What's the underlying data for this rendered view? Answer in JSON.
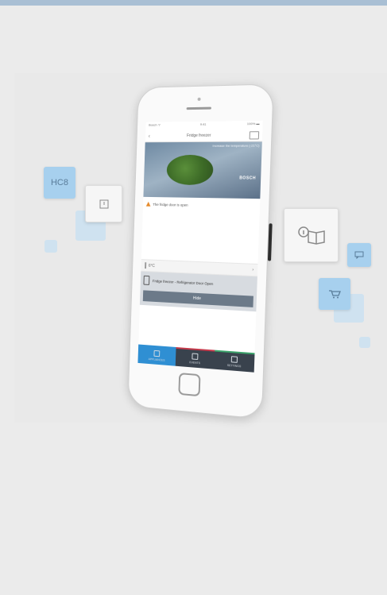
{
  "phone": {
    "status_left": "Bosch ᯤ",
    "status_center": "9:41",
    "status_right": "100% ▬",
    "nav_back": "‹",
    "nav_title": "Fridge freezer",
    "banner_caption": "Increase the temperature (-21°C)",
    "brand_text": "BOSCH",
    "alert_text": "The fridge door is open",
    "temp_value": "6°C",
    "temp_chevron": "›",
    "notice_text": "Fridge freezer - Refrigerator Door Open",
    "notice_button": "Hide",
    "tabs": [
      {
        "label": "APPLIANCES"
      },
      {
        "label": "EVENTS"
      },
      {
        "label": "SETTINGS"
      }
    ]
  },
  "tiles": {
    "tile1_text": "HC8",
    "tile2_icon": "box-icon",
    "tile3_icon": "info-book-icon",
    "tile4_icon": "chat-icon",
    "tile5_icon": "cart-icon"
  },
  "colors": {
    "accent_blue": "#2f8fd3",
    "tile_blue": "#a7d0ee",
    "top_bar": "#a9bfd4",
    "tab_bar": "#39424d",
    "warning": "#e58a2b"
  }
}
